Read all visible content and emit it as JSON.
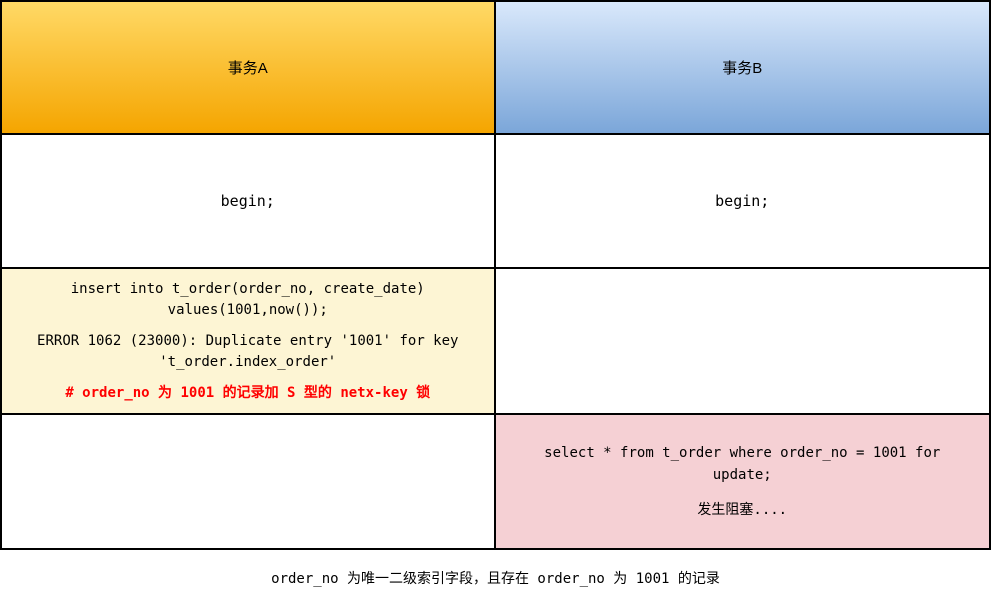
{
  "headers": {
    "a": "事务A",
    "b": "事务B"
  },
  "row_begin": {
    "a": "begin;",
    "b": "begin;"
  },
  "row_insert": {
    "a_line1": "insert into t_order(order_no, create_date)",
    "a_line2": "values(1001,now());",
    "a_error1": "ERROR 1062 (23000): Duplicate entry '1001' for key",
    "a_error2": "'t_order.index_order'",
    "a_comment": "# order_no 为 1001 的记录加 S 型的 netx-key 锁",
    "b": ""
  },
  "row_select": {
    "a": "",
    "b_line1": "select * from t_order where order_no = 1001 for",
    "b_line2": "update;",
    "b_block": "发生阻塞...."
  },
  "caption": "order_no 为唯一二级索引字段，且存在 order_no 为 1001 的记录"
}
